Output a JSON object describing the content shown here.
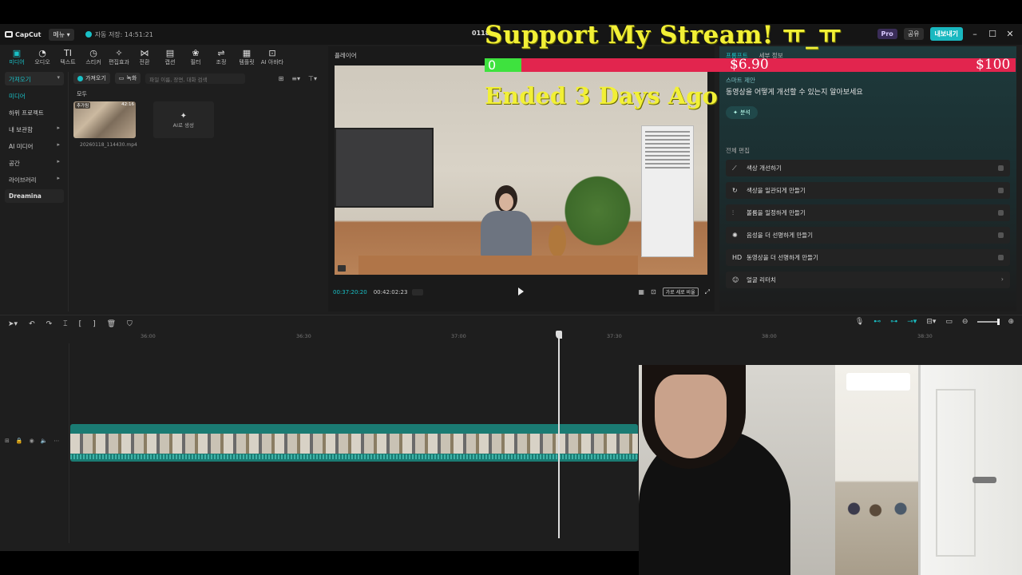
{
  "titlebar": {
    "app_name": "CapCut",
    "menu_label": "메뉴",
    "autosave": "자동 저장: 14:51:21",
    "project_name": "0118",
    "pro_label": "Pro",
    "share_label": "공유",
    "export_label": "내보내기"
  },
  "tooltabs": [
    {
      "label": "미디어",
      "icon": "media-icon"
    },
    {
      "label": "오디오",
      "icon": "audio-icon"
    },
    {
      "label": "텍스트",
      "icon": "text-icon"
    },
    {
      "label": "스티커",
      "icon": "sticker-icon"
    },
    {
      "label": "편집효과",
      "icon": "effects-icon"
    },
    {
      "label": "전환",
      "icon": "transition-icon"
    },
    {
      "label": "캡션",
      "icon": "caption-icon"
    },
    {
      "label": "필터",
      "icon": "filter-icon"
    },
    {
      "label": "조정",
      "icon": "adjust-icon"
    },
    {
      "label": "템플릿",
      "icon": "template-icon"
    },
    {
      "label": "AI 아바타",
      "icon": "ai-avatar-icon"
    }
  ],
  "sidebar": {
    "items": [
      {
        "label": "가져오기"
      },
      {
        "label": "미디어"
      },
      {
        "label": "하위 프로젝트"
      },
      {
        "label": "내 보관함"
      },
      {
        "label": "AI 미디어"
      },
      {
        "label": "공간"
      },
      {
        "label": "라이브러리"
      },
      {
        "label": "Dreamina"
      }
    ]
  },
  "media": {
    "import_label": "가져오기",
    "record_label": "녹화",
    "search_placeholder": "파일 이름, 장면, 대화 검색",
    "all_label": "모두",
    "clip_tag": "추가됨",
    "clip_duration": "42:16",
    "clip_name": "20260118_114430.mp4",
    "ai_tile_label": "AI로 생성"
  },
  "player": {
    "title": "플레이어",
    "current_time": "00:37:20:20",
    "total_time": "00:42:02:23",
    "ratio_label": "가로 세로 비율"
  },
  "right_panel": {
    "tabs": [
      "프롬프트",
      "세부 정보"
    ],
    "smart_label": "스마트 제안",
    "smart_text": "동영상을 어떻게 개선할 수 있는지 알아보세요",
    "analyze_label": "분석",
    "edit_label": "전체 편집",
    "options": [
      {
        "icon": "wand-icon",
        "label": "색상 개선하기"
      },
      {
        "icon": "color-sync-icon",
        "label": "색상을 일관되게 만들기"
      },
      {
        "icon": "sliders-icon",
        "label": "볼륨을 일정하게 만들기"
      },
      {
        "icon": "sparkle-icon",
        "label": "음성을 더 선명하게 만들기"
      },
      {
        "icon": "hd-icon",
        "label": "동영상을 더 선명하게 만들기"
      },
      {
        "icon": "face-retouch-icon",
        "label": "얼굴 리터치"
      }
    ]
  },
  "timeline": {
    "ticks": [
      "36:00",
      "36:30",
      "37:00",
      "37:30",
      "38:00",
      "38:30"
    ]
  },
  "overlay": {
    "support_title": "Support My Stream! ㅠ_ㅠ",
    "goal_start": "0",
    "goal_current": "$6.90",
    "goal_target": "$100",
    "goal_progress": 0.069,
    "ended": "Ended 3 Days Ago"
  },
  "colors": {
    "accent": "#19c0c6",
    "overlay_text": "#f2f036",
    "goal_bar": "#e2254e",
    "goal_fill": "#3ee23e"
  }
}
